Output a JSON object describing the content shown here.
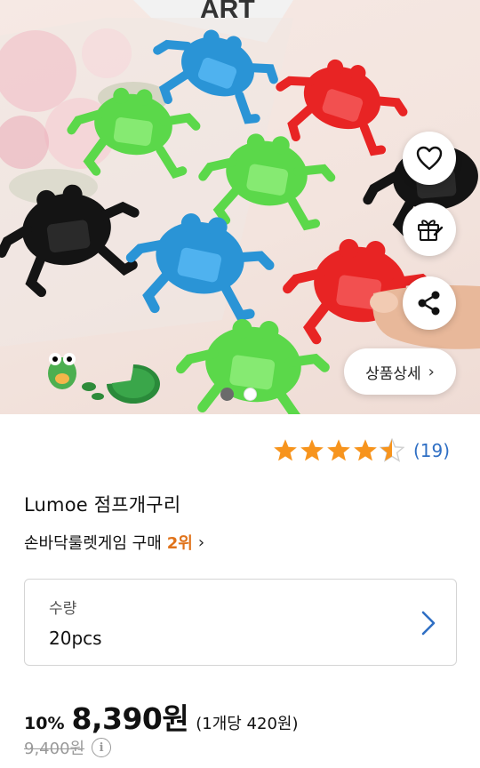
{
  "product": {
    "title": "Lumoe 점프개구리",
    "rating_count": "(19)",
    "rating_value": 4.5,
    "rank_text": "손바닥룰렛게임 구매",
    "rank_value": "2위",
    "image_banner_text": "ART"
  },
  "image_actions": {
    "wishlist_icon": "heart-icon",
    "gift_icon": "gift-icon",
    "share_icon": "share-icon",
    "detail_label": "상품상세",
    "carousel_count": 2,
    "carousel_active": 0
  },
  "option": {
    "label": "수량",
    "value": "20pcs"
  },
  "price": {
    "discount": "10%",
    "sale_price": "8,390원",
    "unit_price": "(1개당 420원)",
    "original_price": "9,400원"
  },
  "colors": {
    "rating_star": "#f7941d",
    "rank_accent": "#e0731b",
    "link_blue": "#2f6fc4"
  }
}
